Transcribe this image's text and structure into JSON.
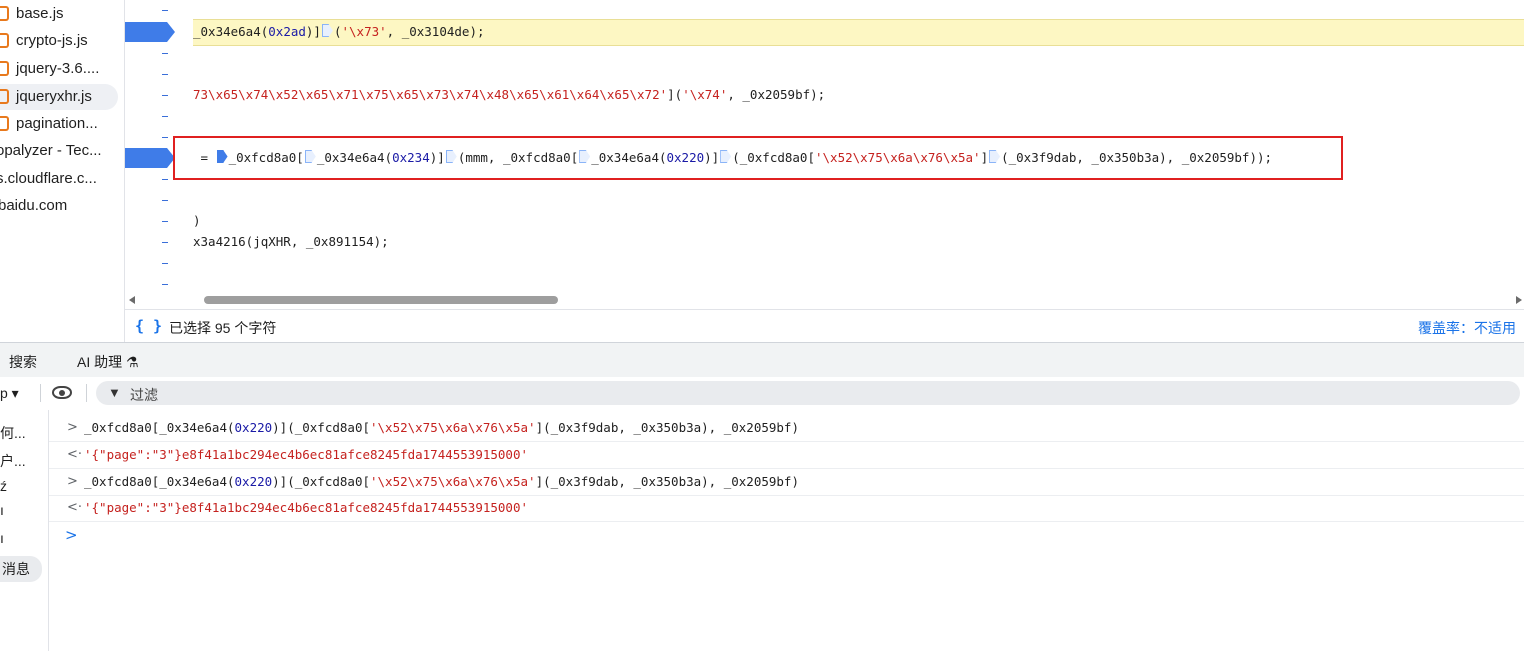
{
  "file_tree": {
    "items": [
      {
        "label": "base.js",
        "selected": false,
        "icon": "file-icon"
      },
      {
        "label": "crypto-js.js",
        "selected": false,
        "icon": "file-icon"
      },
      {
        "label": "jquery-3.6....",
        "selected": false,
        "icon": "file-icon"
      },
      {
        "label": "jqueryxhr.js",
        "selected": true,
        "icon": "file-icon"
      },
      {
        "label": "pagination...",
        "selected": false,
        "icon": "file-icon"
      },
      {
        "label": "opalyzer - Tec...",
        "selected": false,
        "icon": ""
      },
      {
        "label": "s.cloudflare.c...",
        "selected": false,
        "icon": ""
      },
      {
        "label": "baidu.com",
        "selected": false,
        "icon": ""
      }
    ]
  },
  "editor": {
    "line1": {
      "a": "_0x34e6a4(",
      "num": "0x2ad",
      "b": ")]",
      "c": "(",
      "str": "'\\x73'",
      "d": ", _0x3104de);"
    },
    "line2": {
      "str1": "73\\x65\\x74\\x52\\x65\\x71\\x75\\x65\\x73\\x74\\x48\\x65\\x61\\x64\\x65\\x72'",
      "a": "](",
      "str2": "'\\x74'",
      "b": ", _0x2059bf);"
    },
    "line3": {
      "a": " = ",
      "b": "_0xfcd8a0[",
      "c": "_0x34e6a4(",
      "n1": "0x234",
      "d": ")]",
      "e": "(mmm, _0xfcd8a0[",
      "f": "_0x34e6a4(",
      "n2": "0x220",
      "g": ")]",
      "h": "(_0xfcd8a0[",
      "str": "'\\x52\\x75\\x6a\\x76\\x5a'",
      "i": "]",
      "j": "(_0x3f9dab, _0x350b3a), _0x2059bf));"
    },
    "line4": ")",
    "line5": "x3a4216(jqXHR, _0x891154);"
  },
  "status_bar": {
    "braces_icon": "{ }",
    "selection_info": "已选择 95 个字符",
    "coverage": "覆盖率：不适用"
  },
  "drawer_tabs": [
    {
      "label": "搜索"
    },
    {
      "label": "AI 助理 ⚗"
    }
  ],
  "console_toolbar": {
    "context": "p ▾",
    "filter_placeholder": "过滤"
  },
  "console_sidebar": [
    {
      "label": "何..."
    },
    {
      "label": "户..."
    },
    {
      "label": "ź"
    },
    {
      "label": "ı"
    },
    {
      "label": "ı"
    },
    {
      "label": "消息",
      "selected": true
    }
  ],
  "console": {
    "entries": [
      {
        "kind": "input",
        "a": "_0xfcd8a0[_0x34e6a4(",
        "num": "0x220",
        "b": ")](_0xfcd8a0[",
        "str": "'\\x52\\x75\\x6a\\x76\\x5a'",
        "c": "](_0x3f9dab, _0x350b3a), _0x2059bf)"
      },
      {
        "kind": "output",
        "value": "'{\"page\":\"3\"}e8f41a1bc294ec4b6ec81afce8245fda1744553915000'"
      },
      {
        "kind": "input",
        "a": "_0xfcd8a0[_0x34e6a4(",
        "num": "0x220",
        "b": ")](_0xfcd8a0[",
        "str": "'\\x52\\x75\\x6a\\x76\\x5a'",
        "c": "](_0x3f9dab, _0x350b3a), _0x2059bf)"
      },
      {
        "kind": "output",
        "value": "'{\"page\":\"3\"}e8f41a1bc294ec4b6ec81afce8245fda1744553915000'"
      }
    ]
  },
  "colors": {
    "accent": "#1a73e8",
    "string": "#c5221f",
    "number": "#1a1aa6",
    "breakpoint": "#3f7ce8",
    "highlight": "#fdf7c3",
    "selection_box": "#e02020"
  }
}
